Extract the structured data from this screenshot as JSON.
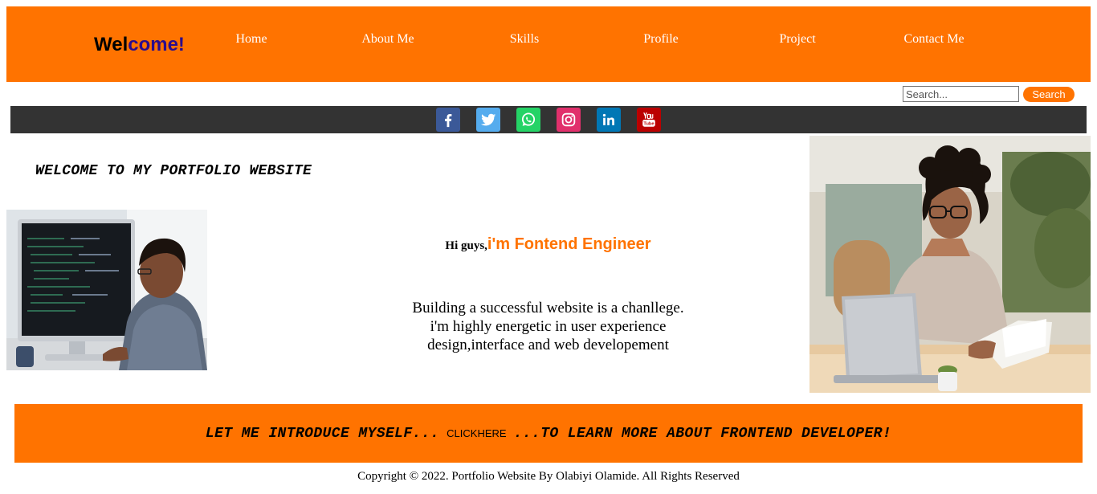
{
  "header": {
    "logo_part1": "Wel",
    "logo_part2": "come!",
    "nav": [
      {
        "label": "Home"
      },
      {
        "label": "About Me"
      },
      {
        "label": "Skills"
      },
      {
        "label": "Profile"
      },
      {
        "label": "Project"
      },
      {
        "label": "Contact Me"
      }
    ]
  },
  "search": {
    "placeholder": "Search...",
    "button_label": "Search"
  },
  "social": [
    {
      "icon": "facebook-icon",
      "color": "#3b5998"
    },
    {
      "icon": "twitter-icon",
      "color": "#55acee"
    },
    {
      "icon": "whatsapp-icon",
      "color": "#25d366"
    },
    {
      "icon": "instagram-icon",
      "color": "#e1306c"
    },
    {
      "icon": "linkedin-icon",
      "color": "#0077b5"
    },
    {
      "icon": "youtube-icon",
      "color": "#bb0000"
    }
  ],
  "main": {
    "welcome_heading": "WELCOME TO MY PORTFOLIO WEBSITE",
    "greeting": "Hi guys,",
    "role": "i'm Fontend Engineer",
    "description_lines": [
      "Building a successful website is a chanllege.",
      "i'm highly energetic in user experience",
      "design,interface and web developement"
    ]
  },
  "cta": {
    "text_before": "LET ME INTRODUCE MYSELF...",
    "link_label": "CLICKHERE",
    "text_after": "...TO LEARN MORE ABOUT FRONTEND DEVELOPER!"
  },
  "footer": {
    "copyright": "Copyright © 2022. Portfolio Website By Olabiyi Olamide. All Rights Reserved"
  },
  "colors": {
    "accent": "#ff7300",
    "social_bar": "#333333",
    "logo_secondary": "#2b0c8c"
  }
}
